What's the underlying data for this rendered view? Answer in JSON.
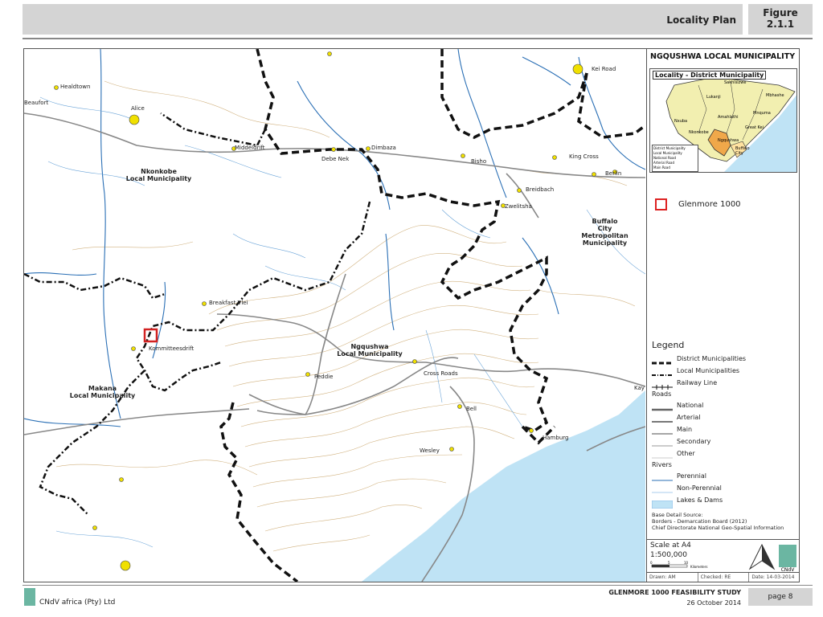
{
  "header": {
    "title": "Locality Plan",
    "figure_label": "Figure",
    "figure_number": "2.1.1"
  },
  "map": {
    "places": [
      {
        "name": "Healdtown"
      },
      {
        "name": "Beaufort"
      },
      {
        "name": "Alice"
      },
      {
        "name": "Middeldrift"
      },
      {
        "name": "Debe Nek"
      },
      {
        "name": "Dimbaza"
      },
      {
        "name": "Bisho"
      },
      {
        "name": "King Cross"
      },
      {
        "name": "Berlin"
      },
      {
        "name": "Breidbach"
      },
      {
        "name": "Zwelitsha"
      },
      {
        "name": "Kei Road"
      },
      {
        "name": "Breakfast Vlei"
      },
      {
        "name": "Kommitteesdrift"
      },
      {
        "name": "Peddie"
      },
      {
        "name": "Cross Roads"
      },
      {
        "name": "Bell"
      },
      {
        "name": "Hamburg"
      },
      {
        "name": "Wesley"
      },
      {
        "name": "Kay"
      }
    ],
    "municipalities": [
      {
        "name": "Nkonkobe\nLocal Municipality"
      },
      {
        "name": "Ngqushwa\nLocal Municipality"
      },
      {
        "name": "Makana\nLocal Municipality"
      },
      {
        "name": "Buffalo\nCity\nMetropolitan\nMunicipality"
      }
    ],
    "colors": {
      "water": "#bfe3f5",
      "river": "#2a6fb5",
      "contour": "#c9a56a",
      "boundary": "#111111",
      "site": "#d22222",
      "town": "#f0e000"
    }
  },
  "sidebar": {
    "title": "NGQUSHWA LOCAL MUNICIPALITY",
    "inset": {
      "title": "Locality - District Municipality",
      "labels": [
        "Lukanji",
        "Sakhisizwe",
        "Mbhashe",
        "Mnquma",
        "Amahlathi",
        "Nxuba",
        "Great Kei",
        "Nkonkobe",
        "Ngqushwa",
        "Buffalo City"
      ],
      "mini_legend": [
        "District Municipality",
        "Local Municipality",
        "National Road",
        "Arterial Road",
        "Main Road"
      ]
    },
    "site_key": "Glenmore 1000",
    "legend": {
      "title": "Legend",
      "boundaries": [
        "District Municipalities",
        "Local Municipalities",
        "Railway Line"
      ],
      "roads_heading": "Roads",
      "roads": [
        "National",
        "Arterial",
        "Main",
        "Secondary",
        "Other"
      ],
      "rivers_heading": "Rivers",
      "rivers": [
        "Perennial",
        "Non-Perennial",
        "Lakes & Dams"
      ]
    },
    "source": [
      "Base Detail Source:",
      "Borders - Demarcation Board (2012)",
      "Chief Directorate National Geo-Spatial Information"
    ],
    "scale": {
      "title": "Scale at A4",
      "ratio": "1:500,000",
      "ticks": [
        "0",
        "5",
        "10"
      ],
      "unit": "Kilometers"
    },
    "credits": {
      "drawn": "Drawn: AM",
      "checked": "Checked: RE",
      "date": "Date: 14-03-2014"
    },
    "logo_text": "CNdV"
  },
  "footer": {
    "company": "CNdV africa (Pty) Ltd",
    "study": "GLENMORE 1000 FEASIBILITY STUDY",
    "date": "26 October 2014",
    "page": "page 8"
  }
}
